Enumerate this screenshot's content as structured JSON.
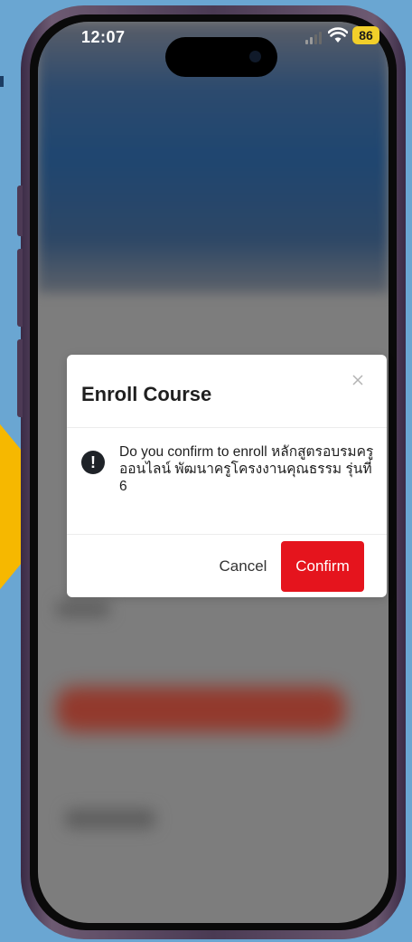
{
  "status_bar": {
    "time": "12:07",
    "battery": "86",
    "signal_icon": "cellular-signal-icon",
    "wifi_icon": "wifi-icon"
  },
  "dialog": {
    "title": "Enroll Course",
    "message": "Do you confirm to enroll หลักสูตรอบรมครูออนไลน์ พัฒนาครูโครงงานคุณธรรม รุ่นที่ 6",
    "close_icon": "close-icon",
    "warning_icon": "exclamation-circle-icon",
    "cancel_label": "Cancel",
    "confirm_label": "Confirm"
  },
  "colors": {
    "background": "#6aa6d2",
    "arrow": "#f6b800",
    "confirm": "#e5141d",
    "battery": "#f2cf2a"
  }
}
